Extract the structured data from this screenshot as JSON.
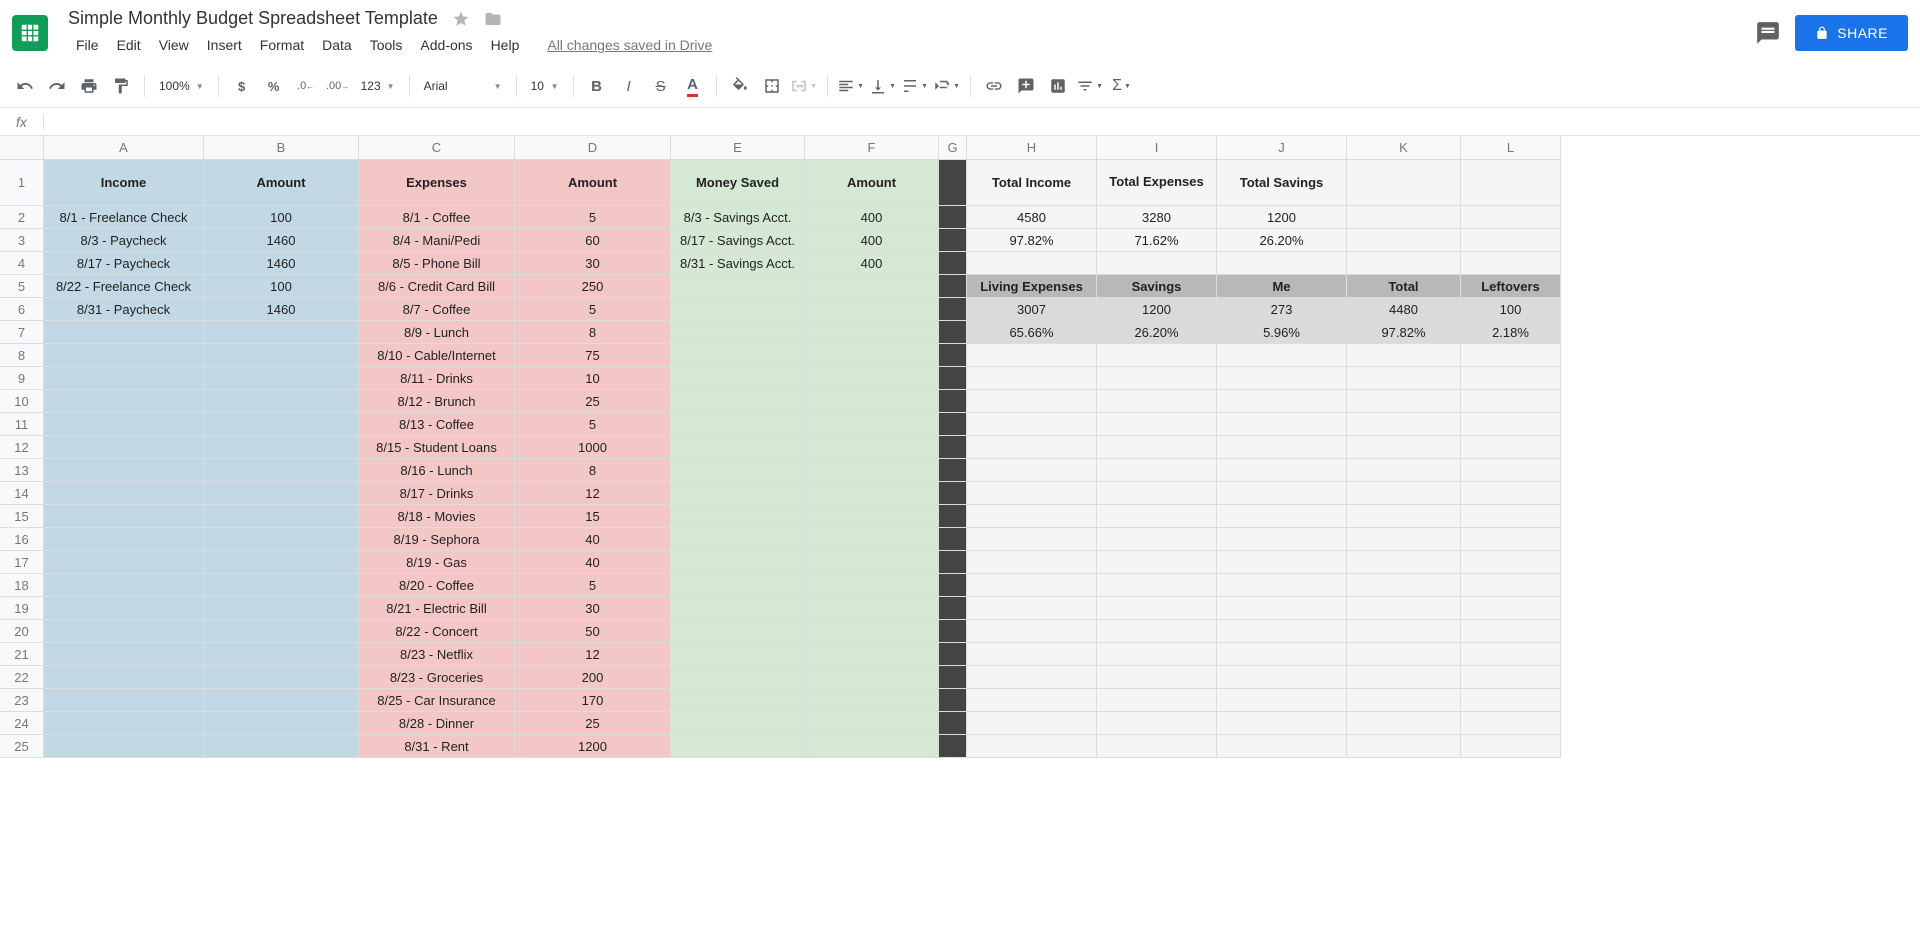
{
  "doc": {
    "title": "Simple Monthly Budget Spreadsheet Template",
    "save_status": "All changes saved in Drive"
  },
  "menu": [
    "File",
    "Edit",
    "View",
    "Insert",
    "Format",
    "Data",
    "Tools",
    "Add-ons",
    "Help"
  ],
  "share": "SHARE",
  "toolbar": {
    "zoom": "100%",
    "font": "Arial",
    "size": "10",
    "more123": "123"
  },
  "cols": [
    "A",
    "B",
    "C",
    "D",
    "E",
    "F",
    "G",
    "H",
    "I",
    "J",
    "K",
    "L"
  ],
  "headers": {
    "income": "Income",
    "amount1": "Amount",
    "expenses": "Expenses",
    "amount2": "Amount",
    "saved": "Money Saved",
    "amount3": "Amount",
    "total_income": "Total Income",
    "total_expenses": "Total Expenses",
    "total_savings": "Total Savings",
    "living": "Living Expenses",
    "savings": "Savings",
    "me": "Me",
    "total": "Total",
    "leftovers": "Leftovers"
  },
  "income": [
    {
      "d": "8/1 - Freelance Check",
      "a": "100"
    },
    {
      "d": "8/3 - Paycheck",
      "a": "1460"
    },
    {
      "d": "8/17 - Paycheck",
      "a": "1460"
    },
    {
      "d": "8/22 - Freelance Check",
      "a": "100"
    },
    {
      "d": "8/31 - Paycheck",
      "a": "1460"
    }
  ],
  "expenses": [
    {
      "d": "8/1 - Coffee",
      "a": "5"
    },
    {
      "d": "8/4 - Mani/Pedi",
      "a": "60"
    },
    {
      "d": "8/5 - Phone Bill",
      "a": "30"
    },
    {
      "d": "8/6 - Credit Card Bill",
      "a": "250"
    },
    {
      "d": "8/7 - Coffee",
      "a": "5"
    },
    {
      "d": "8/9 - Lunch",
      "a": "8"
    },
    {
      "d": "8/10 - Cable/Internet",
      "a": "75"
    },
    {
      "d": "8/11 - Drinks",
      "a": "10"
    },
    {
      "d": "8/12 - Brunch",
      "a": "25"
    },
    {
      "d": "8/13 - Coffee",
      "a": "5"
    },
    {
      "d": "8/15 - Student Loans",
      "a": "1000"
    },
    {
      "d": "8/16 - Lunch",
      "a": "8"
    },
    {
      "d": "8/17 - Drinks",
      "a": "12"
    },
    {
      "d": "8/18 - Movies",
      "a": "15"
    },
    {
      "d": "8/19 - Sephora",
      "a": "40"
    },
    {
      "d": "8/19 - Gas",
      "a": "40"
    },
    {
      "d": "8/20 - Coffee",
      "a": "5"
    },
    {
      "d": "8/21 - Electric Bill",
      "a": "30"
    },
    {
      "d": "8/22 - Concert",
      "a": "50"
    },
    {
      "d": "8/23 - Netflix",
      "a": "12"
    },
    {
      "d": "8/23 - Groceries",
      "a": "200"
    },
    {
      "d": "8/25 - Car Insurance",
      "a": "170"
    },
    {
      "d": "8/28 - Dinner",
      "a": "25"
    },
    {
      "d": "8/31 - Rent",
      "a": "1200"
    }
  ],
  "saved": [
    {
      "d": "8/3 - Savings Acct.",
      "a": "400"
    },
    {
      "d": "8/17 - Savings Acct.",
      "a": "400"
    },
    {
      "d": "8/31 - Savings Acct.",
      "a": "400"
    }
  ],
  "summary": {
    "row2": {
      "ti": "4580",
      "te": "3280",
      "ts": "1200"
    },
    "row3": {
      "ti": "97.82%",
      "te": "71.62%",
      "ts": "26.20%"
    },
    "row6": {
      "living": "3007",
      "savings": "1200",
      "me": "273",
      "total": "4480",
      "left": "100"
    },
    "row7": {
      "living": "65.66%",
      "savings": "26.20%",
      "me": "5.96%",
      "total": "97.82%",
      "left": "2.18%"
    }
  }
}
